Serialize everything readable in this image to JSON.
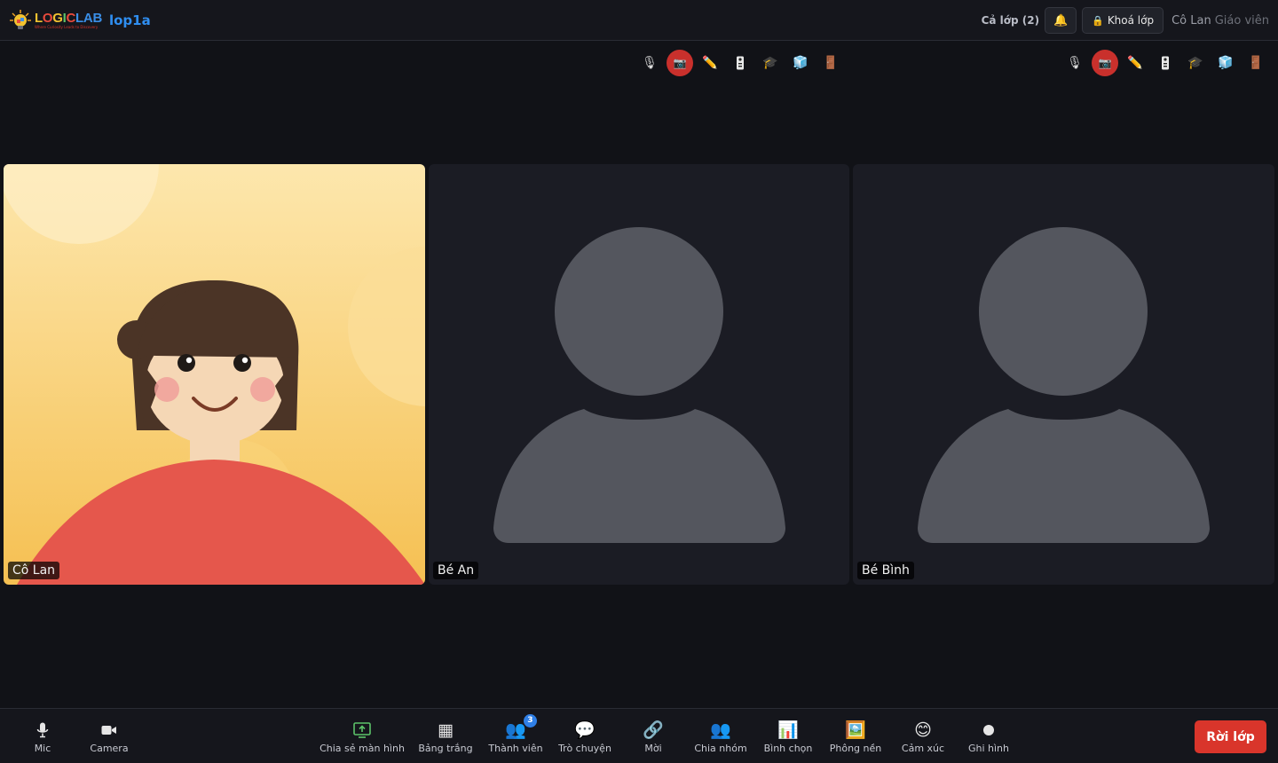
{
  "header": {
    "logo_text": "LOGICLAB",
    "logo_tagline": "Where Curiosity Leads to Discovery",
    "room_name": "lop1a",
    "class_count": "Cả lớp (2)",
    "bell_icon": "bell-icon",
    "lock_label": "Khoá lớp",
    "lock_icon": "lock-icon",
    "user_name": "Cô Lan",
    "user_role": "Giáo viên"
  },
  "tile_toolbar": {
    "icons": [
      "mic-off-icon",
      "camera-off-icon",
      "pencil-icon",
      "remote-icon",
      "graduation-cap-icon",
      "cube-icon",
      "door-icon"
    ]
  },
  "participants": [
    {
      "name": "Cô Lan",
      "video": "teacher-avatar"
    },
    {
      "name": "Bé An",
      "video": "placeholder"
    },
    {
      "name": "Bé Bình",
      "video": "placeholder"
    }
  ],
  "bottombar": {
    "mic": "Mic",
    "camera": "Camera",
    "share_screen": "Chia sẻ màn hình",
    "whiteboard": "Bảng trắng",
    "members": "Thành viên",
    "members_badge": "3",
    "chat": "Trò chuyện",
    "invite": "Mời",
    "breakout": "Chia nhóm",
    "poll": "Bình chọn",
    "background": "Phông nền",
    "reactions": "Cảm xúc",
    "record": "Ghi hình",
    "leave": "Rời lớp"
  },
  "colors": {
    "accent_blue": "#2f8ef0",
    "leave_red": "#d9352b",
    "camera_off_red": "#c9302c",
    "share_green": "#5cc36a"
  }
}
